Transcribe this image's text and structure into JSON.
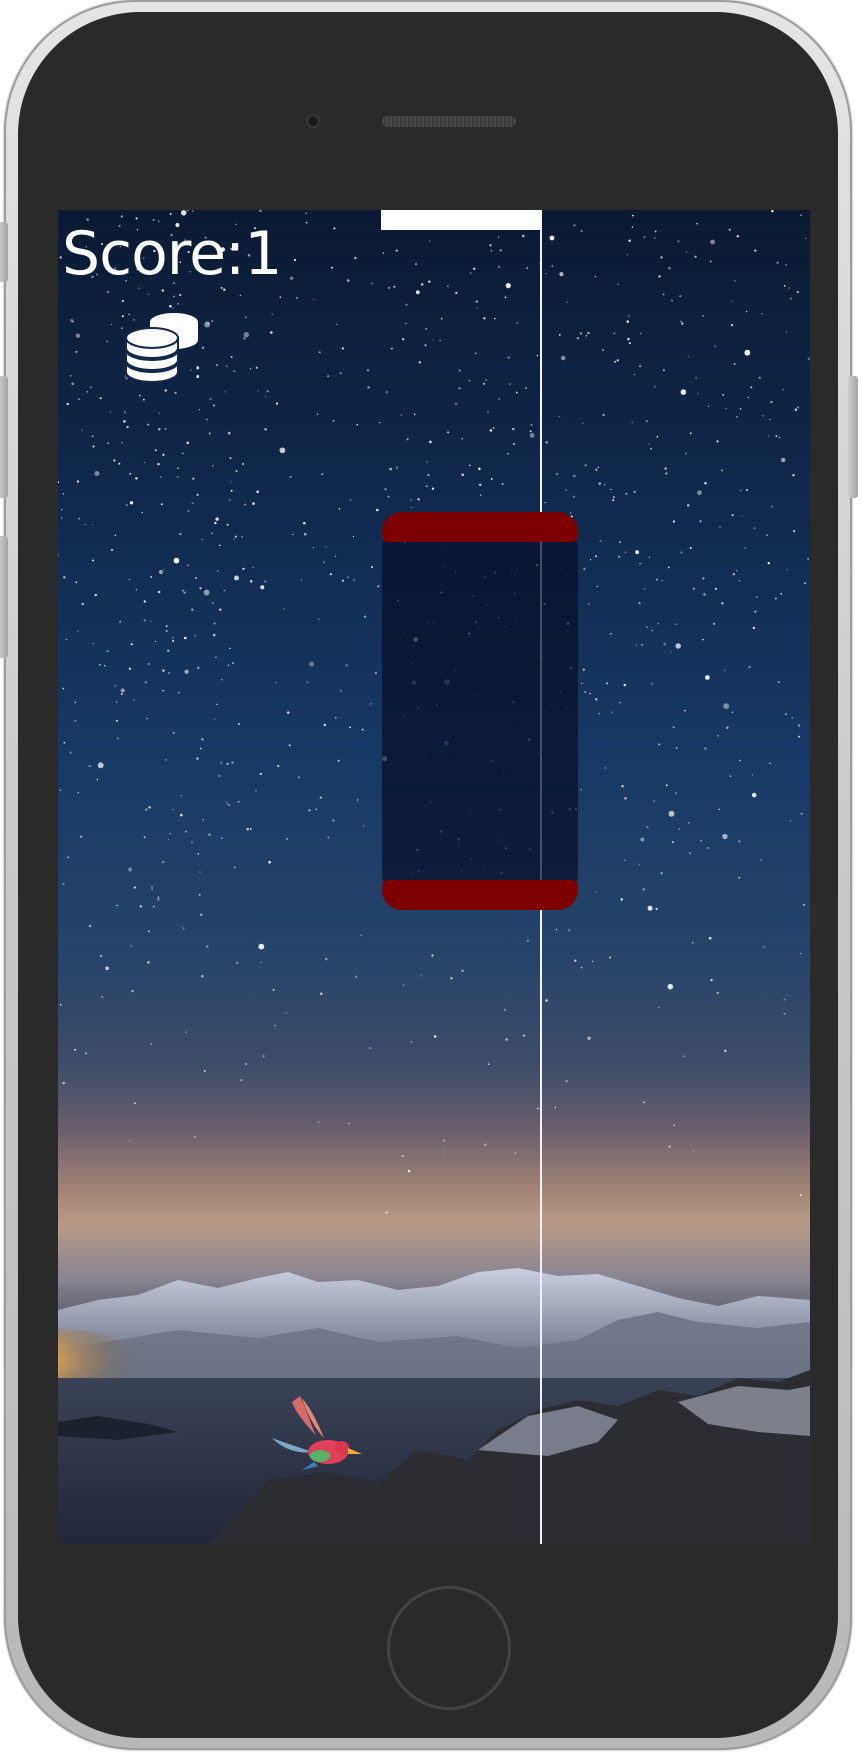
{
  "game": {
    "score_text": "Score:1",
    "score_value": 1
  },
  "icons": {
    "coins": "coins-stack-icon",
    "bird": "bird-icon",
    "home": "home-button"
  },
  "colors": {
    "portal": "#7d0000",
    "score_text": "#ffffff",
    "sky_top": "#0b1a33",
    "device_body": "#2a2a2a"
  }
}
